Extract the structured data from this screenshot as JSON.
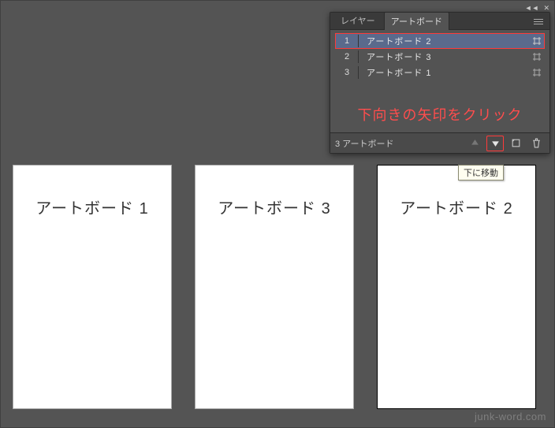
{
  "panel": {
    "tabs": {
      "layers": "レイヤー",
      "artboards": "アートボード"
    },
    "rows": [
      {
        "index": "1",
        "name": "アートボード 2",
        "selected": true
      },
      {
        "index": "2",
        "name": "アートボード 3",
        "selected": false
      },
      {
        "index": "3",
        "name": "アートボード 1",
        "selected": false
      }
    ],
    "annotation": "下向きの矢印をクリック",
    "footer": {
      "count_label": "3 アートボード"
    }
  },
  "tooltip": "下に移動",
  "artboards": {
    "a": "アートボード 1",
    "b": "アートボード 3",
    "c": "アートボード 2"
  },
  "watermark": "junk-word.com"
}
